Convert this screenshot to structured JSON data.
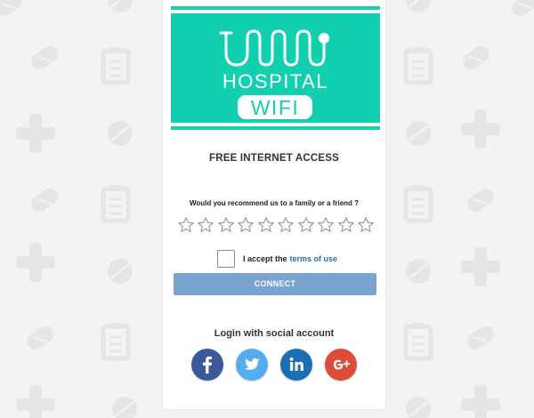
{
  "background": {
    "color": "#f3f3f3",
    "pattern_color": "#e4e4e4",
    "pattern_icons": [
      "pill-icon",
      "clipboard-icon",
      "medical-cross-icon"
    ]
  },
  "logo": {
    "line1": "HOSPITAL",
    "line2": "WIFI",
    "banner_color": "#12cfb0",
    "text_color": "#ffffff"
  },
  "form": {
    "title": "FREE INTERNET ACCESS",
    "question": "Would you recommend us to a family or a friend ?",
    "star_count": 10,
    "stars_selected": 0,
    "terms_prefix": "I accept the",
    "terms_link": "terms of use",
    "terms_checked": false,
    "connect_label": "CONNECT",
    "connect_color": "#79a4d0"
  },
  "social": {
    "title": "Login with social account",
    "buttons": [
      {
        "name": "facebook",
        "icon": "facebook-icon",
        "glyph": "f",
        "color": "#3b5998"
      },
      {
        "name": "twitter",
        "icon": "twitter-icon",
        "glyph": "bird",
        "color": "#55acee"
      },
      {
        "name": "linkedin",
        "icon": "linkedin-icon",
        "glyph": "in",
        "color": "#1c6fb3"
      },
      {
        "name": "google-plus",
        "icon": "google-plus-icon",
        "glyph": "g+",
        "color": "#dd4b39"
      }
    ]
  }
}
